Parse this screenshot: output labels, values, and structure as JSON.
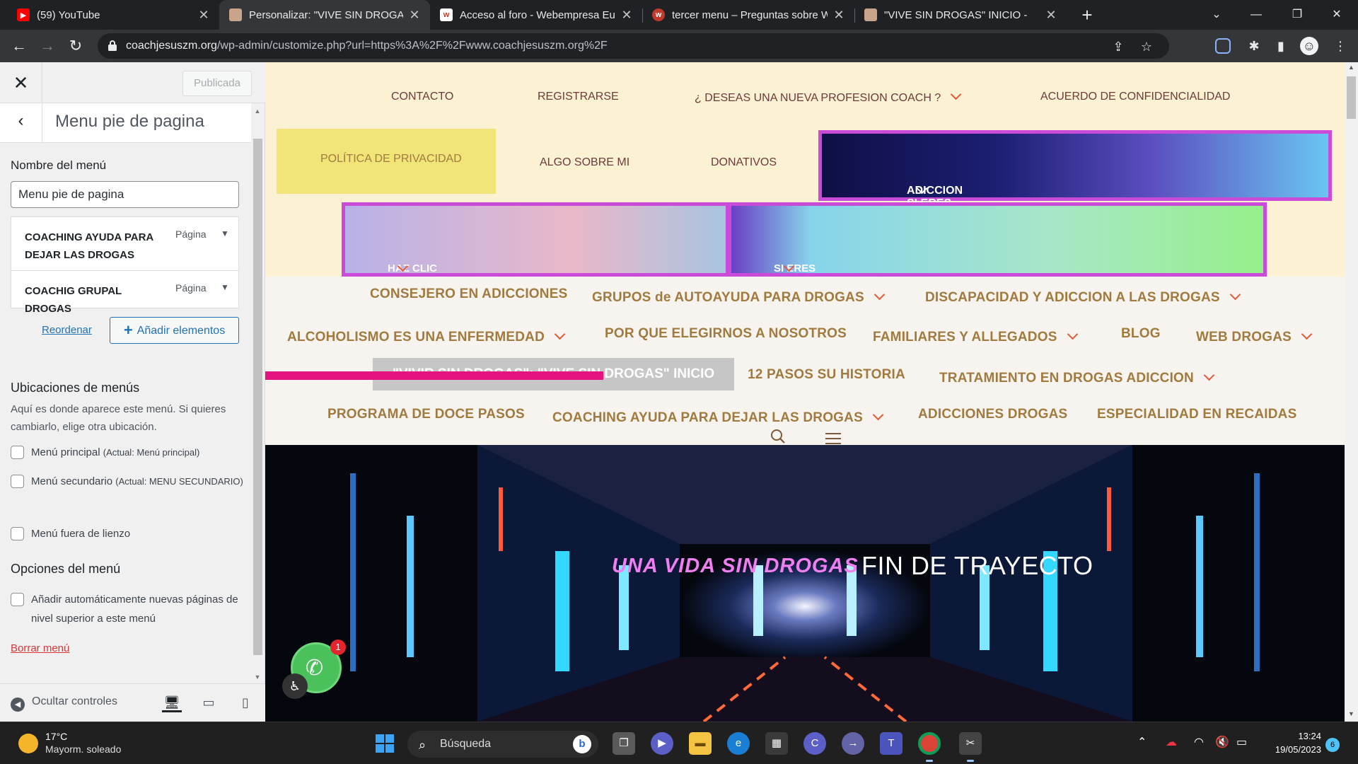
{
  "browser": {
    "tabs": [
      {
        "title": "(59) YouTube",
        "favicon": "youtube-icon"
      },
      {
        "title": "Personalizar: \"VIVE SIN DROGAS\"",
        "favicon": "site-icon",
        "active": true
      },
      {
        "title": "Acceso al foro - Webempresa Eu",
        "favicon": "webempresa-icon"
      },
      {
        "title": "tercer menu – Preguntas sobre W",
        "favicon": "webempresa-icon"
      },
      {
        "title": "\"VIVE SIN DROGAS\" INICIO -",
        "favicon": "site-icon"
      }
    ],
    "url_host": "coachjesuszm.org",
    "url_path": "/wp-admin/customize.php?url=https%3A%2F%2Fwww.coachjesuszm.org%2F"
  },
  "customizer": {
    "publish_label": "Publicada",
    "section_title": "Menu pie de pagina",
    "menu_name_label": "Nombre del menú",
    "menu_name_value": "Menu pie de pagina",
    "items": [
      {
        "title": "COACHING AYUDA PARA DEJAR LAS DROGAS",
        "type": "Página"
      },
      {
        "title": "COACHIG GRUPAL DROGAS",
        "type": "Página"
      }
    ],
    "reorder_label": "Reordenar",
    "add_label": "Añadir elementos",
    "locations_heading": "Ubicaciones de menús",
    "locations_desc": "Aquí es donde aparece este menú. Si quieres cambiarlo, elige otra ubicación.",
    "locations": [
      {
        "label": "Menú principal",
        "note": "(Actual: Menú principal)"
      },
      {
        "label": "Menú secundario",
        "note": "(Actual: MENU SECUNDARIO)"
      },
      {
        "label": "Menú fuera de lienzo",
        "note": ""
      }
    ],
    "options_heading": "Opciones del menú",
    "auto_add_label": "Añadir automáticamente nuevas páginas de nivel superior a este menú",
    "delete_label": "Borrar menú",
    "hide_controls_label": "Ocultar controles"
  },
  "site": {
    "top_menu": [
      "CONTACTO",
      "REGISTRARSE",
      "¿ DESEAS UNA NUEVA PROFESION COACH ?",
      "ACUERDO DE CONFIDENCIALIDAD"
    ],
    "second_menu": [
      "POLÍTICA DE PRIVACIDAD",
      "ALGO SOBRE MI",
      "DONATIVOS"
    ],
    "cta_family": "ADICCION SI ERES FAMILIAR O ALLEGADO PEDIR CITA CON TU COACH.",
    "cta_meetings": "HAZ CLIC DEBAJO PARA ENTRAR A REUNIONES",
    "cta_addict": "SI ERES ADICTO ADICTA ALCOHOLICO PIDE AQUÍ CITA CON TU CONSEJERO",
    "main_menu": [
      "CONSEJERO EN ADICCIONES",
      "GRUPOS de AUTOAYUDA PARA DROGAS",
      "DISCAPACIDAD Y ADICCION A LAS DROGAS",
      "ALCOHOLISMO ES UNA ENFERMEDAD",
      "POR QUE ELEGIRNOS A NOSOTROS",
      "FAMILIARES Y ALLEGADOS",
      "BLOG",
      "WEB DROGAS",
      "\"VIVIR SIN DROGAS\": \"VIVE SIN DROGAS\" INICIO",
      "12 PASOS SU HISTORIA",
      "TRATAMIENTO EN DROGAS ADICCION",
      "PROGRAMA DE DOCE PASOS",
      "COACHING AYUDA PARA DEJAR LAS DROGAS",
      "ADICCIONES DROGAS",
      "ESPECIALIDAD EN RECAIDAS"
    ],
    "hero_neon": "UNA VIDA SIN DROGAS",
    "hero_title": "FIN DE TRAYECTO",
    "whatsapp_badge": "1"
  },
  "taskbar": {
    "temperature": "17°C",
    "condition": "Mayorm. soleado",
    "search_label": "Búsqueda",
    "time": "13:24",
    "date": "19/05/2023",
    "notifications": "6"
  },
  "colors": {
    "accent_pink": "#c94bd8",
    "nav_gold": "#a07a3e",
    "chevron": "#e05a38",
    "highlight_bar": "#e5137f"
  }
}
